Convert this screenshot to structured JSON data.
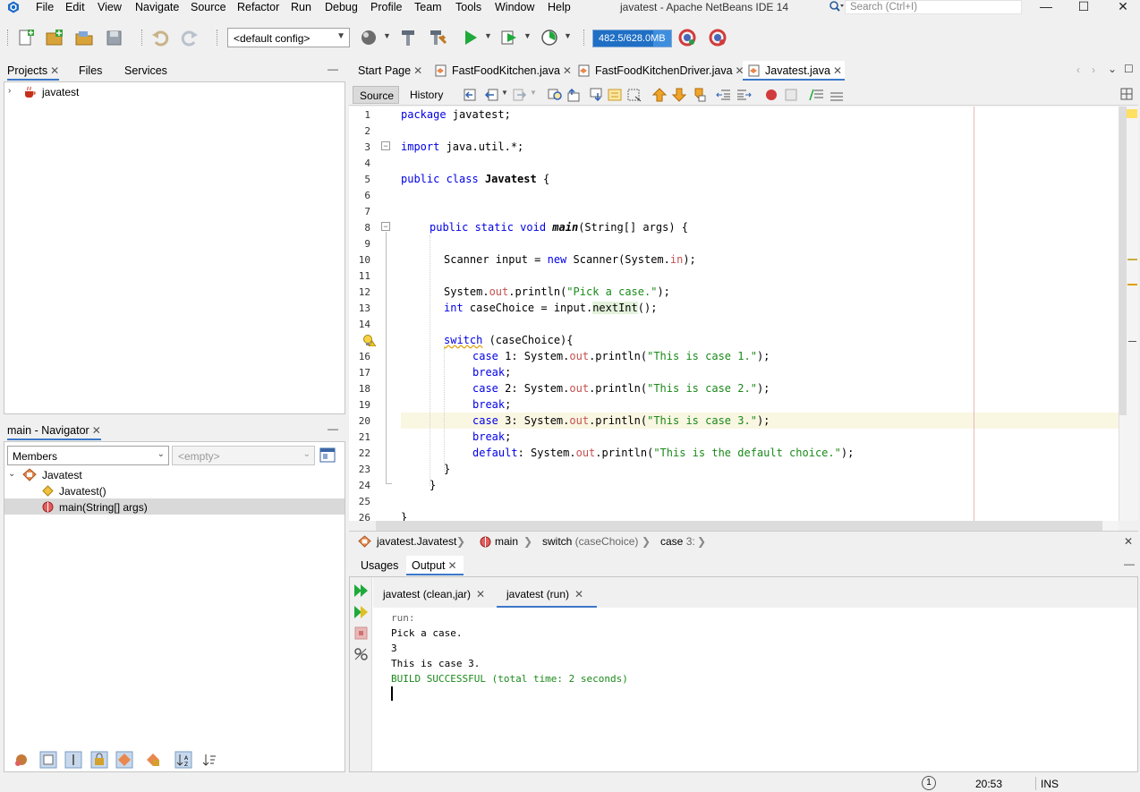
{
  "window": {
    "title": "javatest - Apache NetBeans IDE 14",
    "search_placeholder": "Search (Ctrl+I)",
    "minimize": "—",
    "maximize": "☐",
    "close": "✕"
  },
  "menu": [
    "File",
    "Edit",
    "View",
    "Navigate",
    "Source",
    "Refactor",
    "Run",
    "Debug",
    "Profile",
    "Team",
    "Tools",
    "Window",
    "Help"
  ],
  "toolbar": {
    "config": "<default config>",
    "memory": "482.5/628.0MB",
    "memory_fraction": 0.77
  },
  "projects_panel": {
    "tabs": [
      "Projects",
      "Files",
      "Services"
    ],
    "tree": [
      {
        "label": "javatest"
      }
    ]
  },
  "navigator": {
    "title": "main - Navigator",
    "filter": "Members",
    "second_filter": "<empty>",
    "tree": [
      {
        "label": "Javatest"
      },
      {
        "label": "Javatest()"
      },
      {
        "label": "main(String[] args)"
      }
    ]
  },
  "editor": {
    "tabs": [
      {
        "label": "Start Page"
      },
      {
        "label": "FastFoodKitchen.java"
      },
      {
        "label": "FastFoodKitchenDriver.java"
      },
      {
        "label": "Javatest.java"
      }
    ],
    "subtabs": [
      "Source",
      "History"
    ],
    "line_numbers": [
      "1",
      "2",
      "3",
      "4",
      "5",
      "6",
      "7",
      "8",
      "9",
      "10",
      "11",
      "12",
      "13",
      "14",
      "15",
      "16",
      "17",
      "18",
      "19",
      "20",
      "21",
      "22",
      "23",
      "24",
      "25",
      "26"
    ],
    "code": {
      "l1_kw": "package",
      "l1_rest": " javatest;",
      "l3_kw": "import",
      "l3_rest": " java.util.*;",
      "l5_kw": "public class",
      "l5_name": "Javatest",
      "l5_rest": " {",
      "l8_kw": "public static void",
      "l8_name": "main",
      "l8_rest": "(String[] args) {",
      "l10_a": "Scanner input = ",
      "l10_kw": "new",
      "l10_b": " Scanner(System.",
      "l10_fld": "in",
      "l10_c": ");",
      "l12_a": "System.",
      "l12_fld": "out",
      "l12_b": ".println(",
      "l12_str": "\"Pick a case.\"",
      "l12_c": ");",
      "l13_kw": "int",
      "l13_a": " caseChoice = input.",
      "l13_m": "nextInt",
      "l13_b": "();",
      "l15_kw": "switch",
      "l15_rest": " (caseChoice){",
      "l16_kw": "case",
      "l16_a": " 1: System.",
      "l16_fld": "out",
      "l16_b": ".println(",
      "l16_str": "\"This is case 1.\"",
      "l16_c": ");",
      "l17_kw": "break",
      "l17_c": ";",
      "l18_kw": "case",
      "l18_a": " 2: System.",
      "l18_fld": "out",
      "l18_b": ".println(",
      "l18_str": "\"This is case 2.\"",
      "l18_c": ");",
      "l19_kw": "break",
      "l19_c": ";",
      "l20_kw": "case",
      "l20_a": " 3: System.",
      "l20_fld": "out",
      "l20_b": ".println(",
      "l20_str": "\"This is case 3.\"",
      "l20_c": ");",
      "l21_kw": "break",
      "l21_c": ";",
      "l22_kw": "default",
      "l22_a": ": System.",
      "l22_fld": "out",
      "l22_b": ".println(",
      "l22_str": "\"This is the default choice.\"",
      "l22_c": ");",
      "l23": "}",
      "l24": "}",
      "l26": "}"
    }
  },
  "breadcrumbs": {
    "c1": "javatest.Javatest",
    "c2": "main",
    "c3a": "switch",
    "c3b": " (caseChoice)",
    "c4a": "case",
    "c4b": " 3:"
  },
  "output": {
    "tabs": [
      "Usages",
      "Output"
    ],
    "runs": [
      "javatest (clean,jar)",
      "javatest (run)"
    ],
    "lines": [
      "run:",
      "Pick a case.",
      "3",
      "This is case 3.",
      "BUILD SUCCESSFUL (total time: 2 seconds)"
    ]
  },
  "status": {
    "notifications": "1",
    "position": "20:53",
    "mode": "INS"
  }
}
